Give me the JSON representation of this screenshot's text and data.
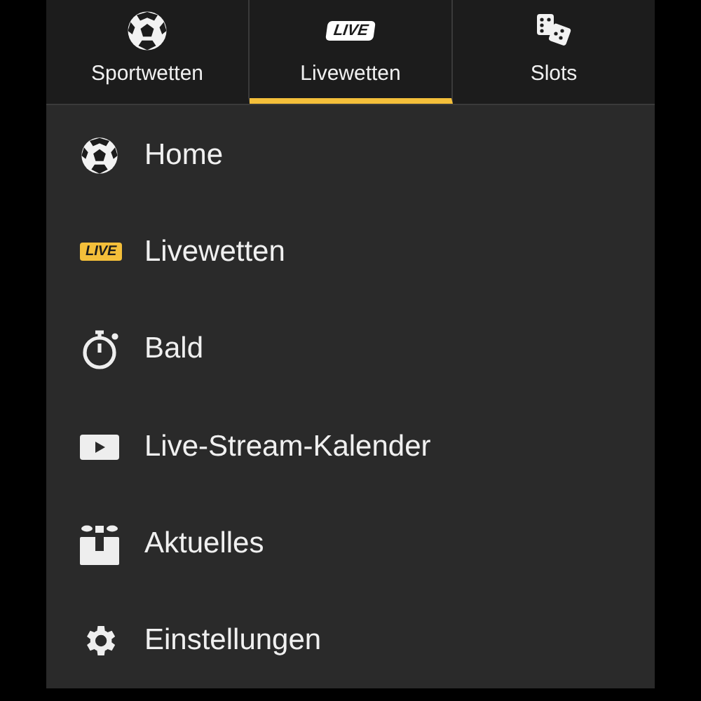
{
  "tabs": [
    {
      "label": "Sportwetten",
      "selected": false,
      "kind": "icon"
    },
    {
      "label": "Livewetten",
      "selected": true,
      "kind": "badge",
      "badge": "LIVE"
    },
    {
      "label": "Slots",
      "selected": false,
      "kind": "icon"
    }
  ],
  "menu": {
    "items": [
      {
        "label": "Home",
        "kind": "icon"
      },
      {
        "label": "Livewetten",
        "kind": "badge",
        "badge": "LIVE"
      },
      {
        "label": "Bald",
        "kind": "icon"
      },
      {
        "label": "Live-Stream-Kalender",
        "kind": "icon"
      },
      {
        "label": "Aktuelles",
        "kind": "icon"
      },
      {
        "label": "Einstellungen",
        "kind": "icon"
      }
    ]
  }
}
